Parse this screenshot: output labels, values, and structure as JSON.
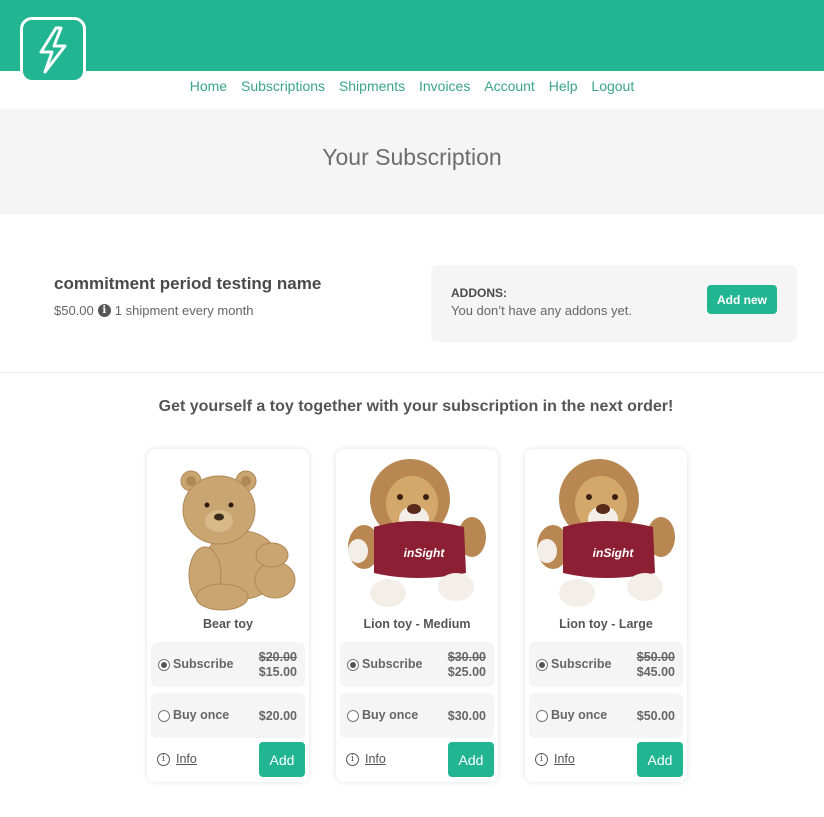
{
  "header": {
    "logo_icon": "lightning-bolt-icon",
    "brand_color": "#21b591"
  },
  "nav": {
    "items": [
      "Home",
      "Subscriptions",
      "Shipments",
      "Invoices",
      "Account",
      "Help",
      "Logout"
    ]
  },
  "hero": {
    "title": "Your Subscription"
  },
  "subscription": {
    "name": "commitment period testing name",
    "price": "$50.00",
    "frequency": "1 shipment every month",
    "info_icon": "info-icon"
  },
  "addons": {
    "title": "ADDONS:",
    "empty_text": "You don’t have any addons yet.",
    "add_label": "Add new"
  },
  "promo": {
    "heading": "Get yourself a toy together with your subscription in the next order!"
  },
  "products": [
    {
      "name": "Bear toy",
      "image": "bear",
      "subscribe_label": "Subscribe",
      "subscribe_old": "$20.00",
      "subscribe_new": "$15.00",
      "once_label": "Buy once",
      "once_price": "$20.00",
      "info_label": "Info",
      "add_label": "Add"
    },
    {
      "name": "Lion toy - Medium",
      "image": "lion",
      "shirt_text": "inSight",
      "subscribe_label": "Subscribe",
      "subscribe_old": "$30.00",
      "subscribe_new": "$25.00",
      "once_label": "Buy once",
      "once_price": "$30.00",
      "info_label": "Info",
      "add_label": "Add"
    },
    {
      "name": "Lion toy - Large",
      "image": "lion",
      "shirt_text": "inSight",
      "subscribe_label": "Subscribe",
      "subscribe_old": "$50.00",
      "subscribe_new": "$45.00",
      "once_label": "Buy once",
      "once_price": "$50.00",
      "info_label": "Info",
      "add_label": "Add"
    }
  ]
}
